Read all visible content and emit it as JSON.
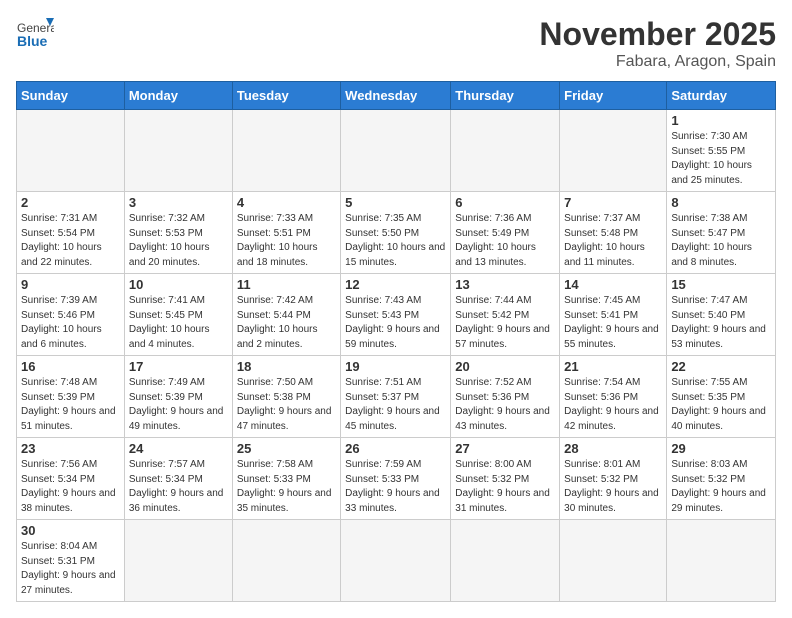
{
  "logo": {
    "line1": "General",
    "line2": "Blue"
  },
  "title": "November 2025",
  "location": "Fabara, Aragon, Spain",
  "weekdays": [
    "Sunday",
    "Monday",
    "Tuesday",
    "Wednesday",
    "Thursday",
    "Friday",
    "Saturday"
  ],
  "days": [
    {
      "date": "",
      "info": ""
    },
    {
      "date": "",
      "info": ""
    },
    {
      "date": "",
      "info": ""
    },
    {
      "date": "",
      "info": ""
    },
    {
      "date": "",
      "info": ""
    },
    {
      "date": "",
      "info": ""
    },
    {
      "date": "1",
      "info": "Sunrise: 7:30 AM\nSunset: 5:55 PM\nDaylight: 10 hours and 25 minutes."
    },
    {
      "date": "2",
      "info": "Sunrise: 7:31 AM\nSunset: 5:54 PM\nDaylight: 10 hours and 22 minutes."
    },
    {
      "date": "3",
      "info": "Sunrise: 7:32 AM\nSunset: 5:53 PM\nDaylight: 10 hours and 20 minutes."
    },
    {
      "date": "4",
      "info": "Sunrise: 7:33 AM\nSunset: 5:51 PM\nDaylight: 10 hours and 18 minutes."
    },
    {
      "date": "5",
      "info": "Sunrise: 7:35 AM\nSunset: 5:50 PM\nDaylight: 10 hours and 15 minutes."
    },
    {
      "date": "6",
      "info": "Sunrise: 7:36 AM\nSunset: 5:49 PM\nDaylight: 10 hours and 13 minutes."
    },
    {
      "date": "7",
      "info": "Sunrise: 7:37 AM\nSunset: 5:48 PM\nDaylight: 10 hours and 11 minutes."
    },
    {
      "date": "8",
      "info": "Sunrise: 7:38 AM\nSunset: 5:47 PM\nDaylight: 10 hours and 8 minutes."
    },
    {
      "date": "9",
      "info": "Sunrise: 7:39 AM\nSunset: 5:46 PM\nDaylight: 10 hours and 6 minutes."
    },
    {
      "date": "10",
      "info": "Sunrise: 7:41 AM\nSunset: 5:45 PM\nDaylight: 10 hours and 4 minutes."
    },
    {
      "date": "11",
      "info": "Sunrise: 7:42 AM\nSunset: 5:44 PM\nDaylight: 10 hours and 2 minutes."
    },
    {
      "date": "12",
      "info": "Sunrise: 7:43 AM\nSunset: 5:43 PM\nDaylight: 9 hours and 59 minutes."
    },
    {
      "date": "13",
      "info": "Sunrise: 7:44 AM\nSunset: 5:42 PM\nDaylight: 9 hours and 57 minutes."
    },
    {
      "date": "14",
      "info": "Sunrise: 7:45 AM\nSunset: 5:41 PM\nDaylight: 9 hours and 55 minutes."
    },
    {
      "date": "15",
      "info": "Sunrise: 7:47 AM\nSunset: 5:40 PM\nDaylight: 9 hours and 53 minutes."
    },
    {
      "date": "16",
      "info": "Sunrise: 7:48 AM\nSunset: 5:39 PM\nDaylight: 9 hours and 51 minutes."
    },
    {
      "date": "17",
      "info": "Sunrise: 7:49 AM\nSunset: 5:39 PM\nDaylight: 9 hours and 49 minutes."
    },
    {
      "date": "18",
      "info": "Sunrise: 7:50 AM\nSunset: 5:38 PM\nDaylight: 9 hours and 47 minutes."
    },
    {
      "date": "19",
      "info": "Sunrise: 7:51 AM\nSunset: 5:37 PM\nDaylight: 9 hours and 45 minutes."
    },
    {
      "date": "20",
      "info": "Sunrise: 7:52 AM\nSunset: 5:36 PM\nDaylight: 9 hours and 43 minutes."
    },
    {
      "date": "21",
      "info": "Sunrise: 7:54 AM\nSunset: 5:36 PM\nDaylight: 9 hours and 42 minutes."
    },
    {
      "date": "22",
      "info": "Sunrise: 7:55 AM\nSunset: 5:35 PM\nDaylight: 9 hours and 40 minutes."
    },
    {
      "date": "23",
      "info": "Sunrise: 7:56 AM\nSunset: 5:34 PM\nDaylight: 9 hours and 38 minutes."
    },
    {
      "date": "24",
      "info": "Sunrise: 7:57 AM\nSunset: 5:34 PM\nDaylight: 9 hours and 36 minutes."
    },
    {
      "date": "25",
      "info": "Sunrise: 7:58 AM\nSunset: 5:33 PM\nDaylight: 9 hours and 35 minutes."
    },
    {
      "date": "26",
      "info": "Sunrise: 7:59 AM\nSunset: 5:33 PM\nDaylight: 9 hours and 33 minutes."
    },
    {
      "date": "27",
      "info": "Sunrise: 8:00 AM\nSunset: 5:32 PM\nDaylight: 9 hours and 31 minutes."
    },
    {
      "date": "28",
      "info": "Sunrise: 8:01 AM\nSunset: 5:32 PM\nDaylight: 9 hours and 30 minutes."
    },
    {
      "date": "29",
      "info": "Sunrise: 8:03 AM\nSunset: 5:32 PM\nDaylight: 9 hours and 29 minutes."
    },
    {
      "date": "30",
      "info": "Sunrise: 8:04 AM\nSunset: 5:31 PM\nDaylight: 9 hours and 27 minutes."
    },
    {
      "date": "",
      "info": ""
    },
    {
      "date": "",
      "info": ""
    },
    {
      "date": "",
      "info": ""
    },
    {
      "date": "",
      "info": ""
    },
    {
      "date": "",
      "info": ""
    },
    {
      "date": "",
      "info": ""
    }
  ]
}
